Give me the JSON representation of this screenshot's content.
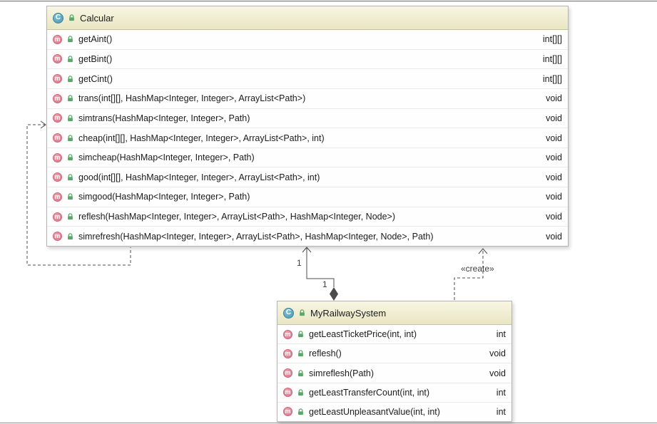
{
  "calcular": {
    "title": "Calcular",
    "methods": [
      {
        "sig": "getAint()",
        "ret": "int[][]"
      },
      {
        "sig": "getBint()",
        "ret": "int[][]"
      },
      {
        "sig": "getCint()",
        "ret": "int[][]"
      },
      {
        "sig": "trans(int[][], HashMap<Integer, Integer>, ArrayList<Path>)",
        "ret": "void"
      },
      {
        "sig": "simtrans(HashMap<Integer, Integer>, Path)",
        "ret": "void"
      },
      {
        "sig": "cheap(int[][], HashMap<Integer, Integer>, ArrayList<Path>, int)",
        "ret": "void"
      },
      {
        "sig": "simcheap(HashMap<Integer, Integer>, Path)",
        "ret": "void"
      },
      {
        "sig": "good(int[][], HashMap<Integer, Integer>, ArrayList<Path>, int)",
        "ret": "void"
      },
      {
        "sig": "simgood(HashMap<Integer, Integer>, Path)",
        "ret": "void"
      },
      {
        "sig": "reflesh(HashMap<Integer, Integer>, ArrayList<Path>, HashMap<Integer, Node>)",
        "ret": "void"
      },
      {
        "sig": "simrefresh(HashMap<Integer, Integer>, ArrayList<Path>, HashMap<Integer, Node>, Path)",
        "ret": "void"
      }
    ]
  },
  "myrailwaysystem": {
    "title": "MyRailwaySystem",
    "methods": [
      {
        "sig": "getLeastTicketPrice(int, int)",
        "ret": "int"
      },
      {
        "sig": "reflesh()",
        "ret": "void"
      },
      {
        "sig": "simreflesh(Path)",
        "ret": "void"
      },
      {
        "sig": "getLeastTransferCount(int, int)",
        "ret": "int"
      },
      {
        "sig": "getLeastUnpleasantValue(int, int)",
        "ret": "int"
      }
    ]
  },
  "edges": {
    "create_label": "«create»",
    "multiplicity_top": "1",
    "multiplicity_bottom": "1"
  },
  "icons": {
    "class_letter": "C",
    "method_letter": "m"
  },
  "colors": {
    "header_bg_top": "#f8f6e2",
    "header_bg_bottom": "#e9e6c4",
    "class_icon": "#4d96ad",
    "method_icon": "#dd7487",
    "lock_green": "#59a869",
    "edge": "#4c4c4c"
  }
}
